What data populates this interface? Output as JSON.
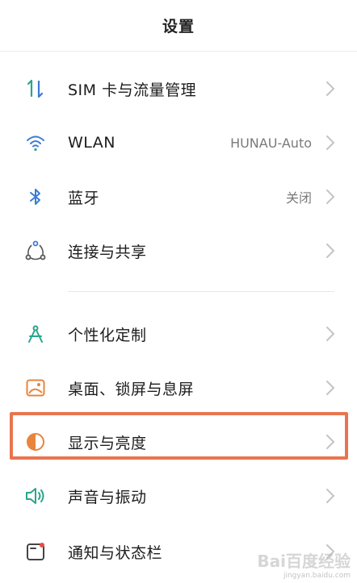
{
  "header": {
    "title": "设置"
  },
  "items": [
    {
      "label": "SIM 卡与流量管理",
      "value": ""
    },
    {
      "label": "WLAN",
      "value": "HUNAU-Auto"
    },
    {
      "label": "蓝牙",
      "value": "关闭"
    },
    {
      "label": "连接与共享",
      "value": ""
    },
    {
      "label": "个性化定制",
      "value": ""
    },
    {
      "label": "桌面、锁屏与息屏",
      "value": ""
    },
    {
      "label": "显示与亮度",
      "value": ""
    },
    {
      "label": "声音与振动",
      "value": ""
    },
    {
      "label": "通知与状态栏",
      "value": ""
    }
  ],
  "icons": [
    "sim-data-icon",
    "wifi-icon",
    "bluetooth-icon",
    "connection-share-icon",
    "personalization-icon",
    "wallpaper-icon",
    "display-brightness-icon",
    "sound-vibration-icon",
    "notification-icon"
  ],
  "colors": {
    "accent_green": "#2aa58a",
    "accent_blue": "#3a7bd5",
    "accent_orange": "#e8843c",
    "highlight_border": "#e8754e"
  },
  "watermark": {
    "main": "Bai百度经验",
    "sub": "jingyan.baidu.com"
  }
}
